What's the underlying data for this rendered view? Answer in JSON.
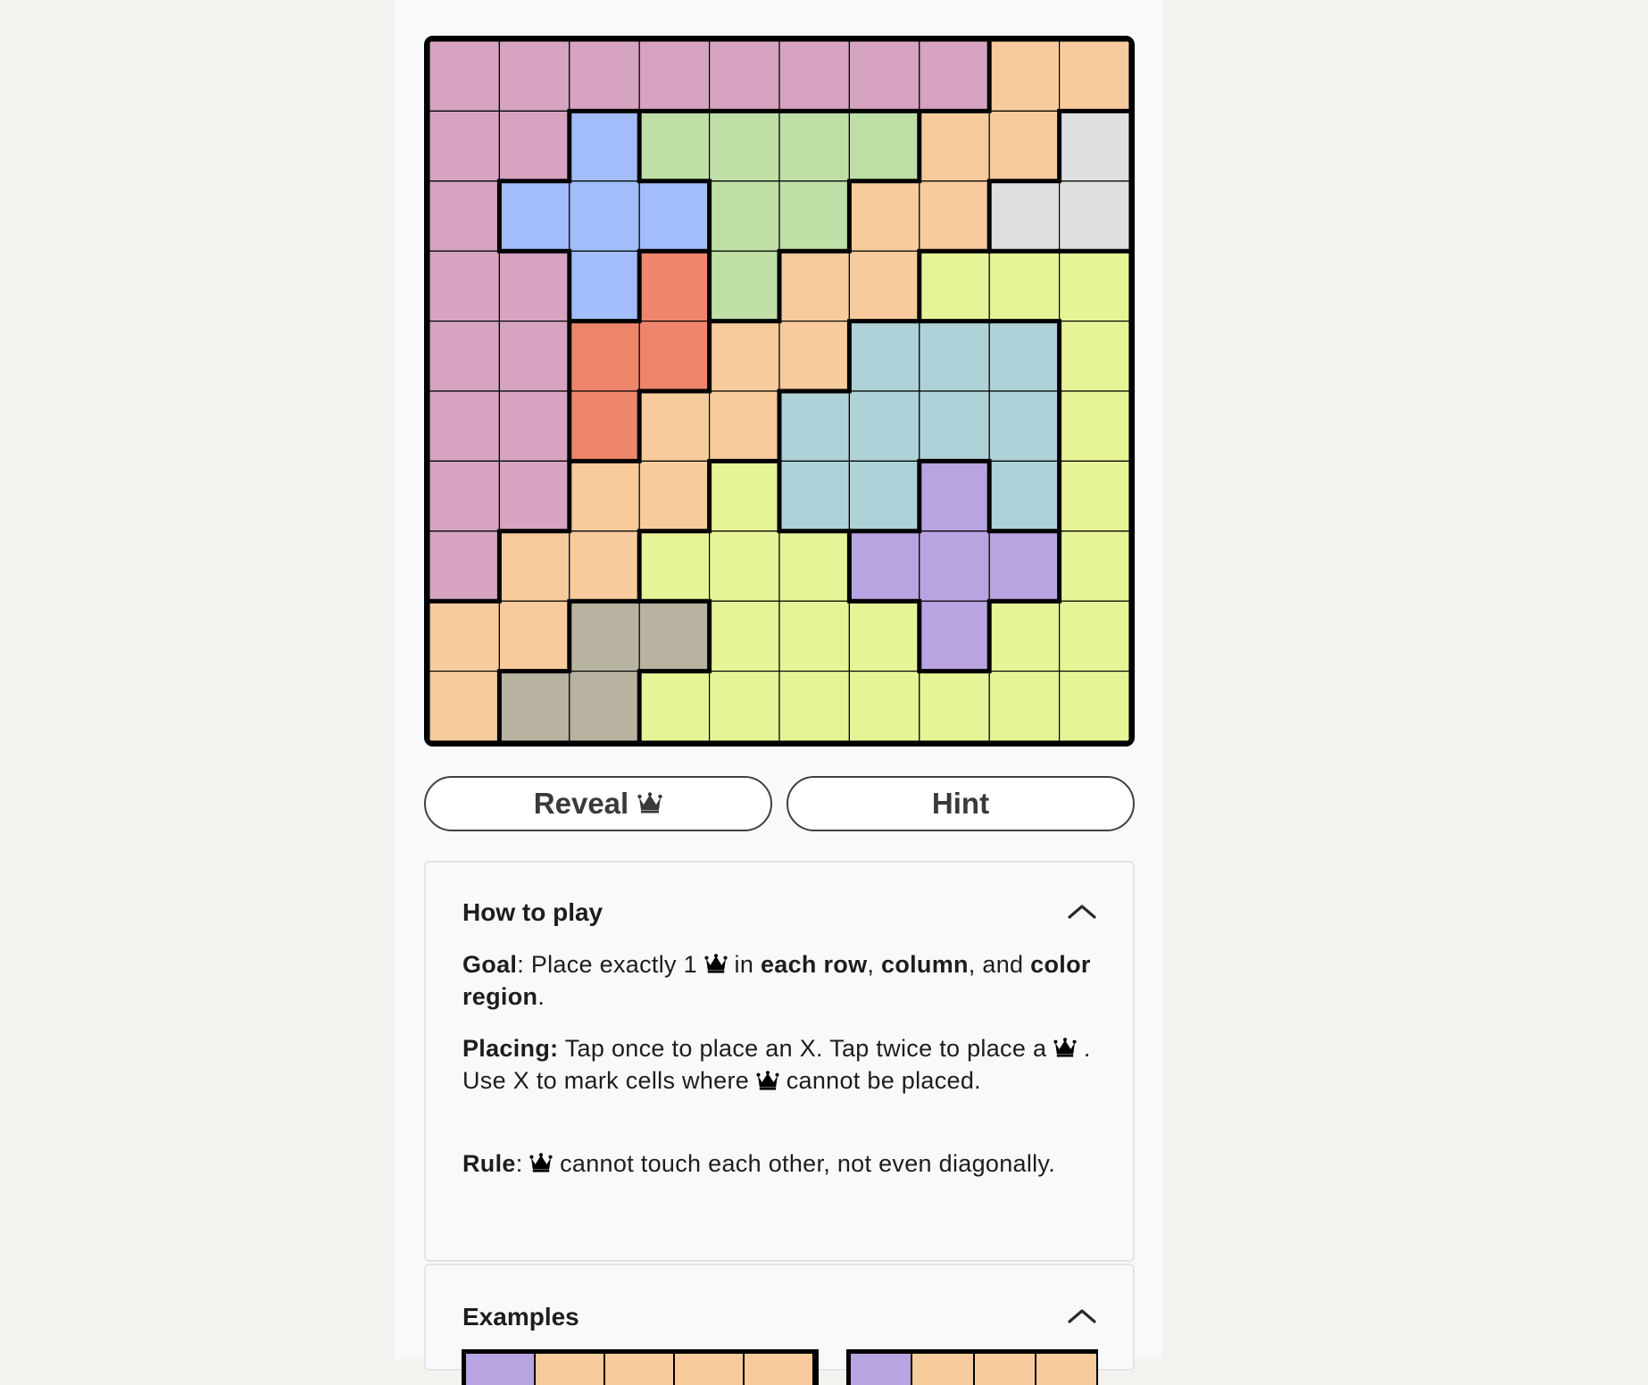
{
  "game": {
    "name": "Queens",
    "grid_size": 10,
    "regions": [
      "AAAAAAAABB",
      "AACDDDDBBE",
      "ACCCDDBBEE",
      "AACFDBBGGG",
      "AAFFBBHHHG",
      "AAFBBHHHHG",
      "AABBGHHIHG",
      "ABBGGGIIIG",
      "BBJJGGGIGG",
      "BJJGGGGGGG"
    ],
    "region_colors": {
      "A": "#d6a3c1",
      "B": "#f7cb9c",
      "C": "#a2bdf9",
      "D": "#bfdfa6",
      "E": "#dfdfdf",
      "F": "#ee866c",
      "G": "#e7f397",
      "H": "#aed2d7",
      "I": "#b8a4e0",
      "J": "#b8b3a0"
    }
  },
  "buttons": {
    "reveal_label": "Reveal",
    "reveal_icon": "crown-icon",
    "hint_label": "Hint"
  },
  "how_to_play": {
    "title": "How to play",
    "goal_label": "Goal",
    "goal_text_1": ": Place exactly 1 ",
    "goal_text_2": " in ",
    "goal_bold_1": "each row",
    "goal_sep_1": ", ",
    "goal_bold_2": "column",
    "goal_sep_2": ", and ",
    "goal_bold_3": "color region",
    "goal_end": ".",
    "placing_label": "Placing:",
    "placing_text_1": " Tap once to place an X. Tap twice to place a ",
    "placing_text_2": " . Use X to mark cells where ",
    "placing_text_3": " cannot be placed.",
    "rule_label": "Rule",
    "rule_text_1": ": ",
    "rule_text_2": " cannot touch each other, not even diagonally."
  },
  "examples": {
    "title": "Examples"
  }
}
